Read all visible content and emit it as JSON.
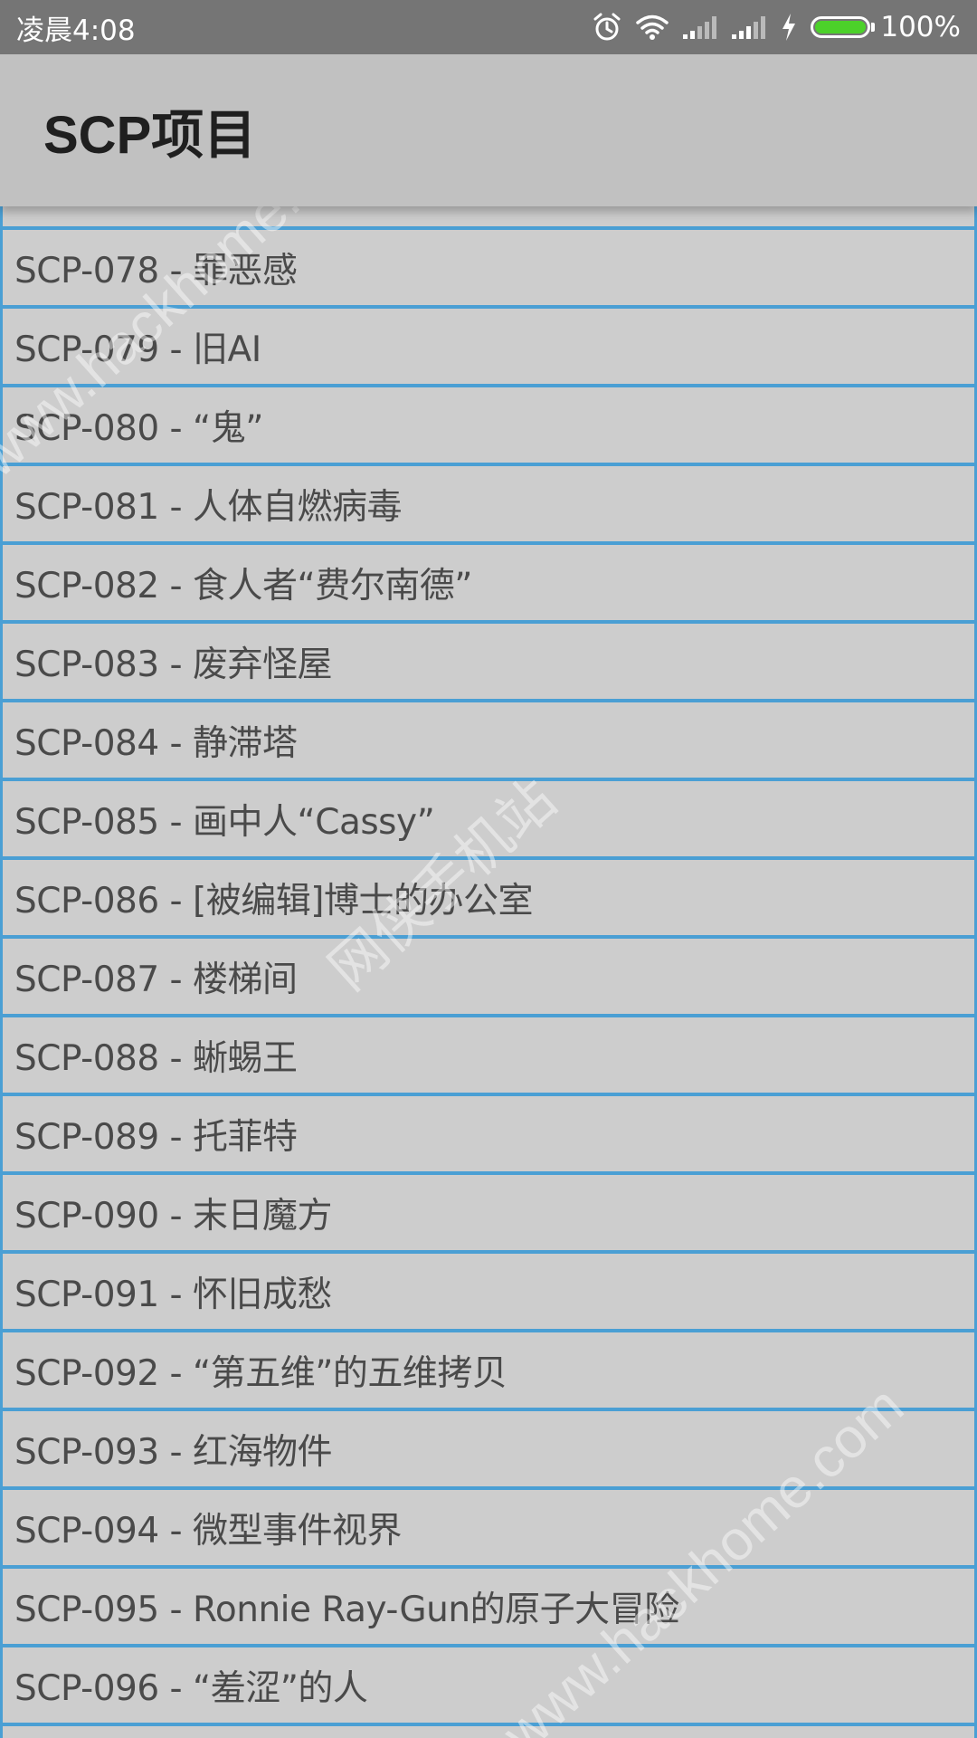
{
  "status_bar": {
    "time": "凌晨4:08",
    "battery_text": "100%",
    "battery_level": 1.0,
    "icons": [
      "alarm-icon",
      "wifi-icon",
      "signal-icon",
      "signal-icon",
      "charging-icon",
      "battery-icon"
    ]
  },
  "app_bar": {
    "title": "SCP项目"
  },
  "list": {
    "items": [
      "SCP-078 - 罪恶感",
      "SCP-079 - 旧AI",
      "SCP-080 - “鬼”",
      "SCP-081 - 人体自燃病毒",
      "SCP-082 - 食人者“费尔南德”",
      "SCP-083 - 废弃怪屋",
      "SCP-084 - 静滞塔",
      "SCP-085 - 画中人“Cassy”",
      "SCP-086 - [被编辑]博士的办公室",
      "SCP-087 - 楼梯间",
      "SCP-088 - 蜥蜴王",
      "SCP-089 - 托菲特",
      "SCP-090 - 末日魔方",
      "SCP-091 - 怀旧成愁",
      "SCP-092 - “第五维”的五维拷贝",
      "SCP-093 - 红海物件",
      "SCP-094 - 微型事件视界",
      "SCP-095 - Ronnie Ray-Gun的原子大冒险",
      "SCP-096 - “羞涩”的人"
    ]
  },
  "watermarks": {
    "wm1": "www.hackhome.com",
    "wm2": "网侠手机站",
    "wm3": "www.hackhome.com"
  },
  "colors": {
    "status_bar": "#757575",
    "app_bar": "#c1c1c1",
    "row_background": "#cdcdcd",
    "row_border": "#4a9fd4",
    "battery_fill": "#4cd12a",
    "text": "#4a4a4a"
  }
}
